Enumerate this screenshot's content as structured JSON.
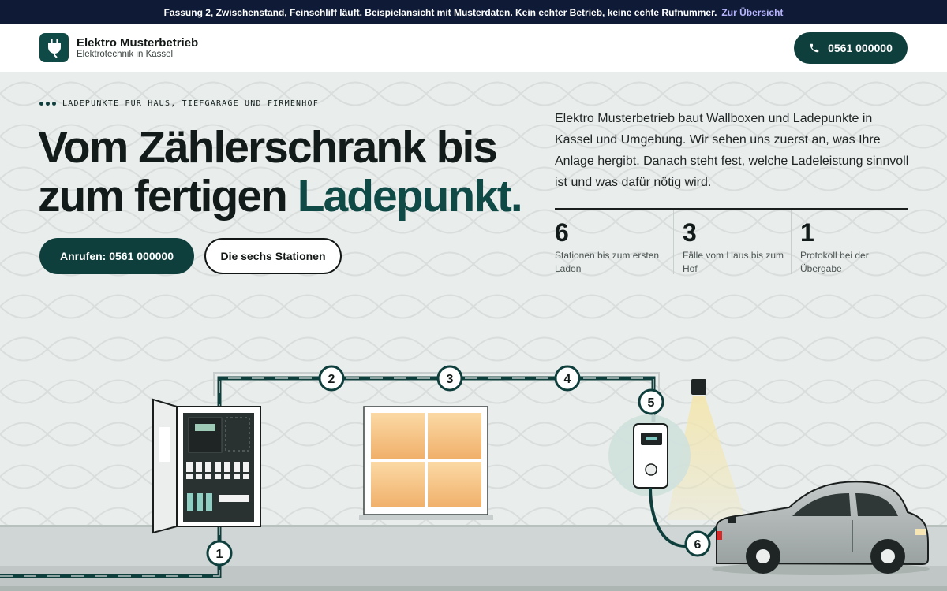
{
  "notice": {
    "text": "Fassung 2, Zwischenstand, Feinschliff läuft. Beispielansicht mit Musterdaten. Kein echter Betrieb, keine echte Rufnummer.",
    "link": "Zur Übersicht"
  },
  "header": {
    "brand_name": "Elektro Musterbetrieb",
    "brand_sub": "Elektrotechnik in Kassel",
    "phone": "0561 000000",
    "logo_icon": "plug-icon",
    "phone_icon": "phone-icon"
  },
  "hero": {
    "eyebrow": "LADEPUNKTE FÜR HAUS, TIEFGARAGE UND FIRMENHOF",
    "headline_part1": "Vom Zählerschrank bis zum fertigen ",
    "headline_accent": "Ladepunkt.",
    "cta_primary": "Anrufen: 0561 000000",
    "cta_secondary": "Die sechs Stationen",
    "intro": "Elektro Musterbetrieb baut Wallboxen und Ladepunkte in Kassel und Umgebung. Wir sehen uns zuerst an, was Ihre Anlage hergibt. Danach steht fest, welche Ladeleistung sinnvoll ist und was dafür nötig wird.",
    "stats": [
      {
        "value": "6",
        "label": "Stationen bis zum ersten Laden"
      },
      {
        "value": "3",
        "label": "Fälle vom Haus bis zum Hof"
      },
      {
        "value": "1",
        "label": "Protokoll bei der Übergabe"
      }
    ]
  },
  "diagram": {
    "stations": [
      "1",
      "2",
      "3",
      "4",
      "5",
      "6"
    ]
  },
  "colors": {
    "notice_bg": "#0f1b36",
    "primary": "#0f3f3c",
    "accent": "#0f4a47",
    "background": "#e9edec",
    "link": "#b7b4ff"
  }
}
